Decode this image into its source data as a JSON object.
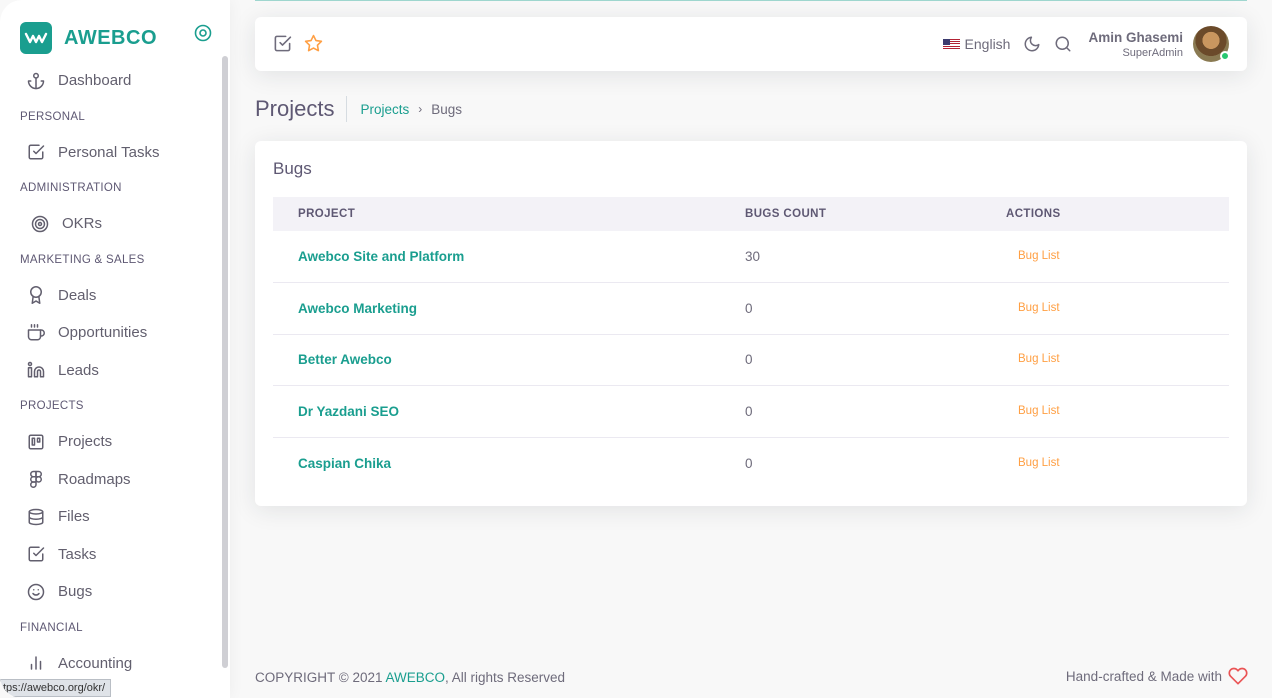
{
  "brand": {
    "name": "AWEBCO",
    "color": "#1a9e8f"
  },
  "sidebar": {
    "items": [
      {
        "type": "item",
        "label": "Dashboard",
        "icon": "anchor-icon"
      },
      {
        "type": "header",
        "label": "PERSONAL"
      },
      {
        "type": "item",
        "label": "Personal Tasks",
        "icon": "checkbox-icon"
      },
      {
        "type": "header",
        "label": "ADMINISTRATION"
      },
      {
        "type": "item",
        "label": "OKRs",
        "icon": "target-icon"
      },
      {
        "type": "header",
        "label": "MARKETING & SALES"
      },
      {
        "type": "item",
        "label": "Deals",
        "icon": "award-icon"
      },
      {
        "type": "item",
        "label": "Opportunities",
        "icon": "coffee-icon"
      },
      {
        "type": "item",
        "label": "Leads",
        "icon": "linkedin-icon"
      },
      {
        "type": "header",
        "label": "PROJECTS"
      },
      {
        "type": "item",
        "label": "Projects",
        "icon": "trello-icon"
      },
      {
        "type": "item",
        "label": "Roadmaps",
        "icon": "figma-icon"
      },
      {
        "type": "item",
        "label": "Files",
        "icon": "database-icon"
      },
      {
        "type": "item",
        "label": "Tasks",
        "icon": "checkbox-icon"
      },
      {
        "type": "item",
        "label": "Bugs",
        "icon": "smile-icon"
      },
      {
        "type": "header",
        "label": "FINANCIAL"
      },
      {
        "type": "item",
        "label": "Accounting",
        "icon": "bar-chart-icon"
      }
    ]
  },
  "status_url": "tps://awebco.org/okr/",
  "navbar": {
    "language": "English",
    "user_name": "Amin Ghasemi",
    "user_role": "SuperAdmin"
  },
  "page": {
    "title": "Projects",
    "breadcrumb": {
      "link": "Projects",
      "separator": "›",
      "current": "Bugs"
    }
  },
  "card": {
    "title": "Bugs",
    "columns": [
      "PROJECT",
      "BUGS COUNT",
      "ACTIONS"
    ],
    "rows": [
      {
        "project": "Awebco Site and Platform",
        "count": "30",
        "action": "Bug List"
      },
      {
        "project": "Awebco Marketing",
        "count": "0",
        "action": "Bug List"
      },
      {
        "project": "Better Awebco",
        "count": "0",
        "action": "Bug List"
      },
      {
        "project": "Dr Yazdani SEO",
        "count": "0",
        "action": "Bug List"
      },
      {
        "project": "Caspian Chika",
        "count": "0",
        "action": "Bug List"
      }
    ]
  },
  "footer": {
    "copyright_prefix": "COPYRIGHT © 2021 ",
    "copyright_brand": "AWEBCO",
    "copyright_suffix": ", All rights Reserved",
    "right_text": "Hand-crafted & Made with"
  }
}
